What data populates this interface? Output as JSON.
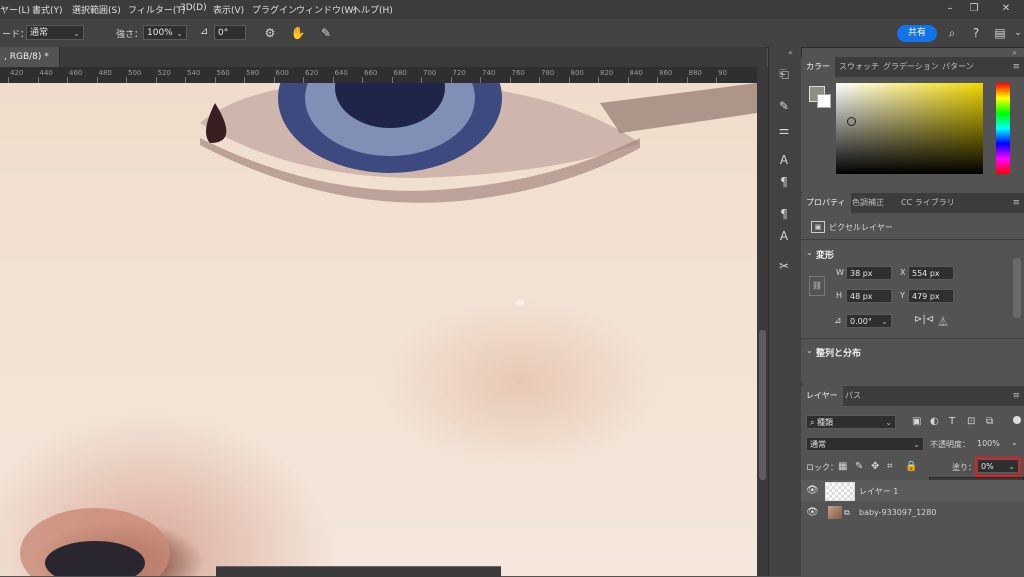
{
  "menubar": {
    "items": [
      "ヤー(L)",
      "書式(Y)",
      "選択範囲(S)",
      "フィルター(T)",
      "3D(D)",
      "表示(V)",
      "プラグイン",
      "ウィンドウ(W)",
      "ヘルプ(H)"
    ]
  },
  "options": {
    "mode_label": "ード：",
    "mode_value": "通常",
    "strength_label": "強さ：",
    "strength_value": "100%",
    "angle_value": "0°",
    "share_label": "共有"
  },
  "document": {
    "tab_title": ", RGB/8) *",
    "close": "×",
    "ruler_ticks": [
      "420",
      "440",
      "460",
      "480",
      "500",
      "520",
      "540",
      "560",
      "580",
      "600",
      "620",
      "640",
      "660",
      "680",
      "700",
      "720",
      "740",
      "760",
      "780",
      "800",
      "820",
      "840",
      "860",
      "880",
      "90"
    ]
  },
  "color_panel": {
    "tabs": [
      "カラー",
      "スウォッチ",
      "グラデーション",
      "パターン"
    ]
  },
  "properties_panel": {
    "tabs": [
      "プロパティ",
      "色調補正",
      "CC ライブラリ"
    ],
    "layer_type": "ピクセルレイヤー",
    "transform_title": "変形",
    "w_label": "W",
    "w_value": "38 px",
    "h_label": "H",
    "h_value": "48 px",
    "x_label": "X",
    "x_value": "554 px",
    "y_label": "Y",
    "y_value": "479 px",
    "angle_value": "0.00°",
    "align_title": "整列と分布"
  },
  "layers_panel": {
    "tabs": [
      "レイヤー",
      "パス"
    ],
    "filter_kind": "種類",
    "blend_mode": "通常",
    "opacity_label": "不透明度：",
    "opacity_value": "100%",
    "lock_label": "ロック：",
    "fill_label": "塗り：",
    "fill_value": "0%",
    "fill_slider_level": 0,
    "layers": [
      {
        "name": "レイヤー 1"
      },
      {
        "name": "baby-933097_1280"
      }
    ]
  },
  "colors": {
    "accent": "#1473e6",
    "highlight_box": "#e02020"
  }
}
